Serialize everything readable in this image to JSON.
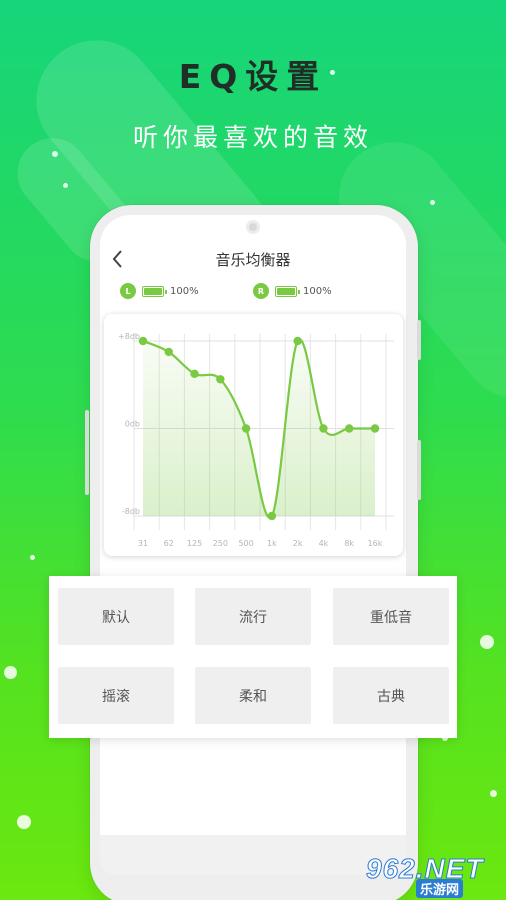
{
  "hero": {
    "title": "EQ设置",
    "subtitle": "听你最喜欢的音效"
  },
  "screen": {
    "title": "音乐均衡器",
    "back_icon": "chevron-left-icon"
  },
  "channels": [
    {
      "badge": "L",
      "battery_level": 1.0,
      "percent": "100%"
    },
    {
      "badge": "R",
      "battery_level": 1.0,
      "percent": "100%"
    }
  ],
  "presets": [
    "默认",
    "流行",
    "重低音",
    "摇滚",
    "柔和",
    "古典"
  ],
  "colors": {
    "accent": "#7ac943",
    "background_top": "#16d57a",
    "background_bottom": "#6be80f"
  },
  "watermark": {
    "number": "962",
    "suffix": ".NET",
    "text": "乐游网"
  },
  "chart_data": {
    "type": "line",
    "categories": [
      "31",
      "62",
      "125",
      "250",
      "500",
      "1k",
      "2k",
      "4k",
      "8k",
      "16k"
    ],
    "series": [
      {
        "values": [
          8,
          7,
          5,
          4.5,
          0,
          -8,
          8,
          0,
          0,
          0
        ]
      }
    ],
    "y_tick_labels": [
      "+8db",
      "0db",
      "-8db"
    ],
    "ylim": [
      -8,
      8
    ],
    "grid": true,
    "fill": "area-under-curve"
  }
}
